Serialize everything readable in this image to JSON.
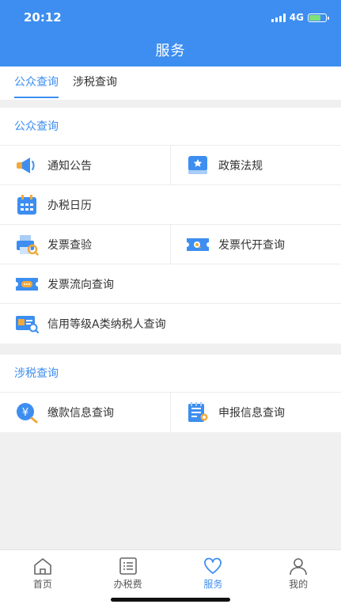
{
  "status": {
    "time": "20:12",
    "network": "4G"
  },
  "header": {
    "title": "服务"
  },
  "tabs": [
    {
      "label": "公众查询",
      "active": true
    },
    {
      "label": "涉税查询",
      "active": false
    }
  ],
  "public": {
    "title": "公众查询",
    "items": {
      "notice": "通知公告",
      "policy": "政策法规",
      "calendar": "办税日历",
      "invoice_check": "发票查验",
      "invoice_proxy": "发票代开查询",
      "invoice_flow": "发票流向查询",
      "credit": "信用等级A类纳税人查询"
    }
  },
  "tax": {
    "title": "涉税查询",
    "items": {
      "payment": "缴款信息查询",
      "declare": "申报信息查询"
    }
  },
  "icons": {
    "payment_symbol": "¥"
  },
  "tabbar": [
    {
      "label": "首页",
      "icon": "home-icon"
    },
    {
      "label": "办税费",
      "icon": "list-icon"
    },
    {
      "label": "服务",
      "icon": "heart-icon",
      "active": true
    },
    {
      "label": "我的",
      "icon": "user-icon"
    }
  ],
  "colors": {
    "accent": "#3d8ef0",
    "background": "#f0f0f0"
  }
}
